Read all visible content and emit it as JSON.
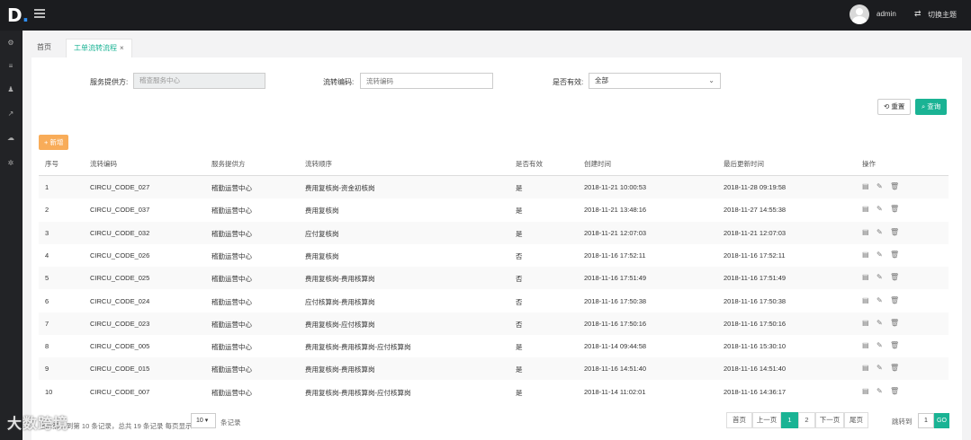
{
  "header": {
    "logo_letter": "D",
    "logo_dot": ".",
    "username": "admin",
    "switch_label": "切换主题"
  },
  "tabs": [
    {
      "label": "首页"
    },
    {
      "label": "工单流转流程",
      "close": "×"
    }
  ],
  "search": {
    "provider_label": "服务提供方:",
    "provider_value": "稽查服务中心",
    "code_label": "流转编码:",
    "code_placeholder": "流转编码",
    "valid_label": "是否有效:",
    "valid_value": "全部",
    "reset_label": "重置",
    "search_label": "查询"
  },
  "toolbar": {
    "add_label": "+ 新增"
  },
  "table": {
    "headers": [
      "序号",
      "流转编码",
      "服务提供方",
      "流转顺序",
      "是否有效",
      "创建时间",
      "最后更新时间",
      "操作"
    ],
    "rows": [
      {
        "no": "1",
        "code": "CIRCU_CODE_027",
        "provider": "稽勤运营中心",
        "order": "费用复核岗-资金初核岗",
        "valid": "是",
        "created": "2018-11-21 10:00:53",
        "updated": "2018-11-28 09:19:58"
      },
      {
        "no": "2",
        "code": "CIRCU_CODE_037",
        "provider": "稽勤运营中心",
        "order": "费用复核岗",
        "valid": "是",
        "created": "2018-11-21 13:48:16",
        "updated": "2018-11-27 14:55:38"
      },
      {
        "no": "3",
        "code": "CIRCU_CODE_032",
        "provider": "稽勤运营中心",
        "order": "应付复核岗",
        "valid": "是",
        "created": "2018-11-21 12:07:03",
        "updated": "2018-11-21 12:07:03"
      },
      {
        "no": "4",
        "code": "CIRCU_CODE_026",
        "provider": "稽勤运营中心",
        "order": "费用复核岗",
        "valid": "否",
        "created": "2018-11-16 17:52:11",
        "updated": "2018-11-16 17:52:11"
      },
      {
        "no": "5",
        "code": "CIRCU_CODE_025",
        "provider": "稽勤运营中心",
        "order": "费用复核岗-费用核算岗",
        "valid": "否",
        "created": "2018-11-16 17:51:49",
        "updated": "2018-11-16 17:51:49"
      },
      {
        "no": "6",
        "code": "CIRCU_CODE_024",
        "provider": "稽勤运营中心",
        "order": "应付核算岗-费用核算岗",
        "valid": "否",
        "created": "2018-11-16 17:50:38",
        "updated": "2018-11-16 17:50:38"
      },
      {
        "no": "7",
        "code": "CIRCU_CODE_023",
        "provider": "稽勤运营中心",
        "order": "费用复核岗-应付核算岗",
        "valid": "否",
        "created": "2018-11-16 17:50:16",
        "updated": "2018-11-16 17:50:16"
      },
      {
        "no": "8",
        "code": "CIRCU_CODE_005",
        "provider": "稽勤运营中心",
        "order": "费用复核岗-费用核算岗-应付核算岗",
        "valid": "是",
        "created": "2018-11-14 09:44:58",
        "updated": "2018-11-16 15:30:10"
      },
      {
        "no": "9",
        "code": "CIRCU_CODE_015",
        "provider": "稽勤运营中心",
        "order": "费用复核岗-费用核算岗",
        "valid": "是",
        "created": "2018-11-16 14:51:40",
        "updated": "2018-11-16 14:51:40"
      },
      {
        "no": "10",
        "code": "CIRCU_CODE_007",
        "provider": "稽勤运营中心",
        "order": "费用复核岗-费用核算岗-应付核算岗",
        "valid": "是",
        "created": "2018-11-14 11:02:01",
        "updated": "2018-11-16 14:36:17"
      }
    ]
  },
  "pager": {
    "info": "显示第 1 到第 10 条记录，总共 19 条记录 每页显示",
    "page_size": "10",
    "page_size_suffix": "条记录",
    "first": "首页",
    "prev": "上一页",
    "pages": [
      "1",
      "2"
    ],
    "next": "下一页",
    "last": "尾页",
    "jump_label": "跳转到",
    "jump_value": "1",
    "go": "GO"
  },
  "watermark": "大数跨境",
  "icons": {
    "menu": "menu-icon",
    "avatar": "user-avatar-icon",
    "switch": "switch-icon",
    "view": "view-icon",
    "edit": "edit-icon",
    "delete": "delete-icon"
  }
}
